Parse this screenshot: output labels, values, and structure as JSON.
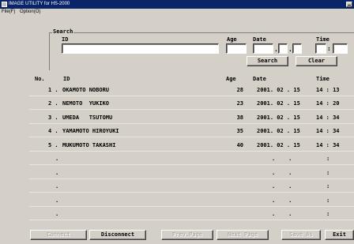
{
  "window": {
    "title": "IMAGE UTILITY for HS-2000"
  },
  "menu": {
    "items": [
      "File(F)",
      "Option(O)"
    ]
  },
  "search": {
    "legend": "Search",
    "id_label": "ID",
    "age_label": "Age",
    "date_label": "Date",
    "time_label": "Time",
    "date_sep": ".",
    "time_sep": ":",
    "id_value": "",
    "age_value": "",
    "search_button": "Search",
    "clear_button": "Clear"
  },
  "table": {
    "headers": {
      "no": "No.",
      "id": "ID",
      "age": "Age",
      "date": "Date",
      "time": "Time"
    },
    "rows": [
      {
        "no": "1 .",
        "id": "OKAMOTO NOBORU",
        "age": "28",
        "date": "2001. 02 . 15",
        "time": "14 : 13"
      },
      {
        "no": "2 .",
        "id": "NEMOTO  YUKIKO",
        "age": "23",
        "date": "2001. 02 . 15",
        "time": "14 : 20"
      },
      {
        "no": "3 .",
        "id": "UMEDA   TSUTOMU",
        "age": "38",
        "date": "2001. 02 . 15",
        "time": "14 : 34"
      },
      {
        "no": "4 .",
        "id": "YAMAMOTO HIROYUKI",
        "age": "35",
        "date": "2001. 02 . 15",
        "time": "14 : 34"
      },
      {
        "no": "5 .",
        "id": "MUKUMOTO TAKASHI",
        "age": "40",
        "date": "2001. 02 . 15",
        "time": "14 : 34"
      },
      {
        "no": ".",
        "id": "",
        "age": "",
        "date": ".    .",
        "time": ":"
      },
      {
        "no": ".",
        "id": "",
        "age": "",
        "date": ".    .",
        "time": ":"
      },
      {
        "no": ".",
        "id": "",
        "age": "",
        "date": ".    .",
        "time": ":"
      },
      {
        "no": ".",
        "id": "",
        "age": "",
        "date": ".    .",
        "time": ":"
      },
      {
        "no": ".",
        "id": "",
        "age": "",
        "date": ".    .",
        "time": ":"
      }
    ]
  },
  "footer": {
    "connect": "Connect",
    "disconnect": "Disconnect",
    "prev_page": "Prev.Page",
    "next_page": "Next Page",
    "save_as": "Save As",
    "exit": "Exit"
  }
}
